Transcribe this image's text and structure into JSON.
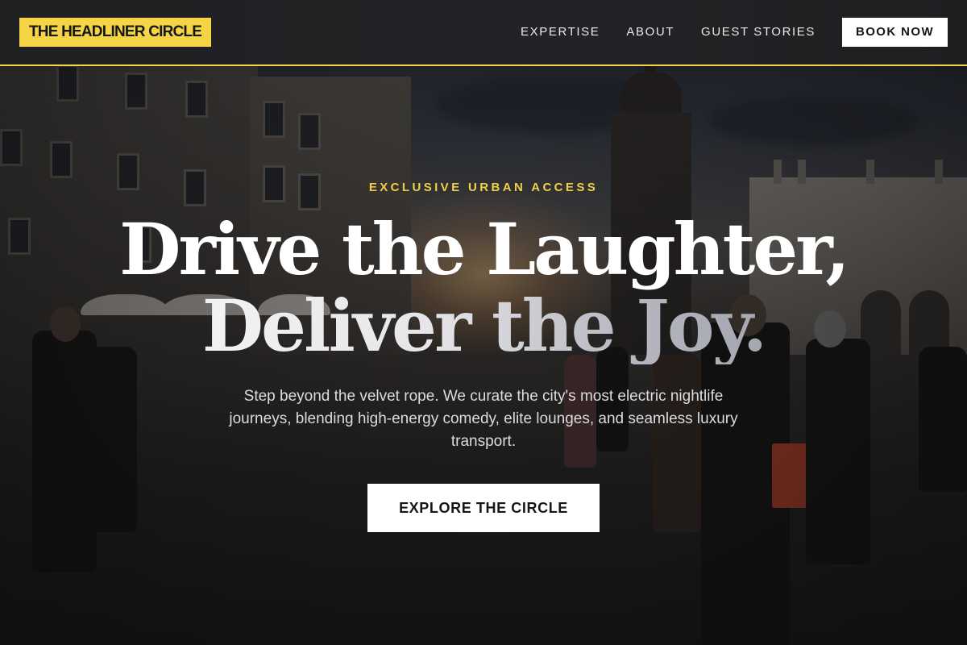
{
  "brand": {
    "logo_text": "THE HEADLINER CIRCLE",
    "accent_color": "#f5d546",
    "header_background": "#1f2022"
  },
  "nav": {
    "links": [
      {
        "label": "EXPERTISE"
      },
      {
        "label": "ABOUT"
      },
      {
        "label": "GUEST STORIES"
      }
    ],
    "cta_label": "BOOK NOW"
  },
  "hero": {
    "eyebrow": "EXCLUSIVE URBAN ACCESS",
    "headline_line1": "Drive the Laughter,",
    "headline_line2": "Deliver the Joy.",
    "description": "Step beyond the velvet rope. We curate the city's most electric nightlife journeys, blending high-energy comedy, elite lounges, and seamless luxury transport.",
    "cta_label": "EXPLORE THE CIRCLE",
    "background_image": "city-square-at-dusk"
  }
}
